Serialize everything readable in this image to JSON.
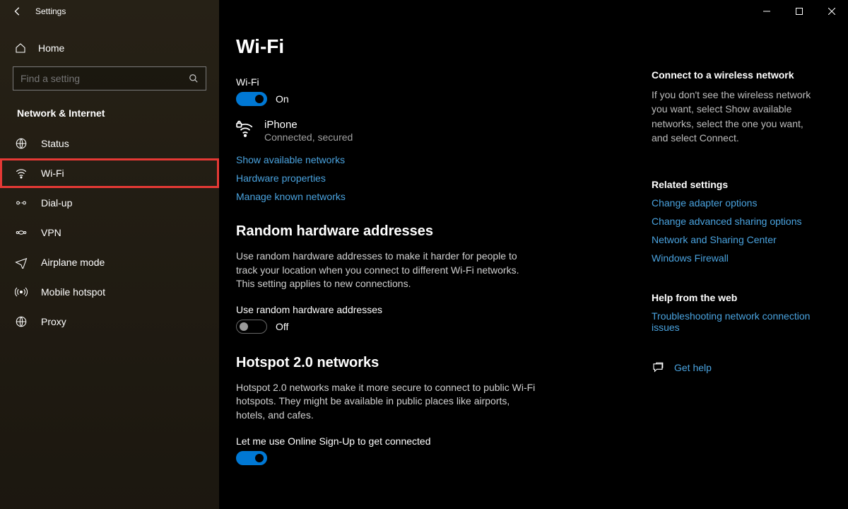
{
  "window": {
    "title": "Settings"
  },
  "sidebar": {
    "home_label": "Home",
    "search_placeholder": "Find a setting",
    "category": "Network & Internet",
    "items": [
      {
        "label": "Status"
      },
      {
        "label": "Wi-Fi"
      },
      {
        "label": "Dial-up"
      },
      {
        "label": "VPN"
      },
      {
        "label": "Airplane mode"
      },
      {
        "label": "Mobile hotspot"
      },
      {
        "label": "Proxy"
      }
    ]
  },
  "page": {
    "title": "Wi-Fi",
    "wifi_label": "Wi-Fi",
    "wifi_state": "On",
    "network": {
      "name": "iPhone",
      "status": "Connected, secured"
    },
    "links": {
      "show_networks": "Show available networks",
      "hw_props": "Hardware properties",
      "manage_known": "Manage known networks"
    },
    "random": {
      "heading": "Random hardware addresses",
      "desc": "Use random hardware addresses to make it harder for people to track your location when you connect to different Wi-Fi networks. This setting applies to new connections.",
      "toggle_label": "Use random hardware addresses",
      "toggle_state": "Off"
    },
    "hotspot": {
      "heading": "Hotspot 2.0 networks",
      "desc": "Hotspot 2.0 networks make it more secure to connect to public Wi-Fi hotspots. They might be available in public places like airports, hotels, and cafes.",
      "toggle_label": "Let me use Online Sign-Up to get connected"
    }
  },
  "aside": {
    "connect": {
      "heading": "Connect to a wireless network",
      "desc": "If you don't see the wireless network you want, select Show available networks, select the one you want, and select Connect."
    },
    "related": {
      "heading": "Related settings",
      "links": {
        "adapter": "Change adapter options",
        "sharing": "Change advanced sharing options",
        "center": "Network and Sharing Center",
        "firewall": "Windows Firewall"
      }
    },
    "help": {
      "heading": "Help from the web",
      "link": "Troubleshooting network connection issues"
    },
    "gethelp": "Get help"
  }
}
